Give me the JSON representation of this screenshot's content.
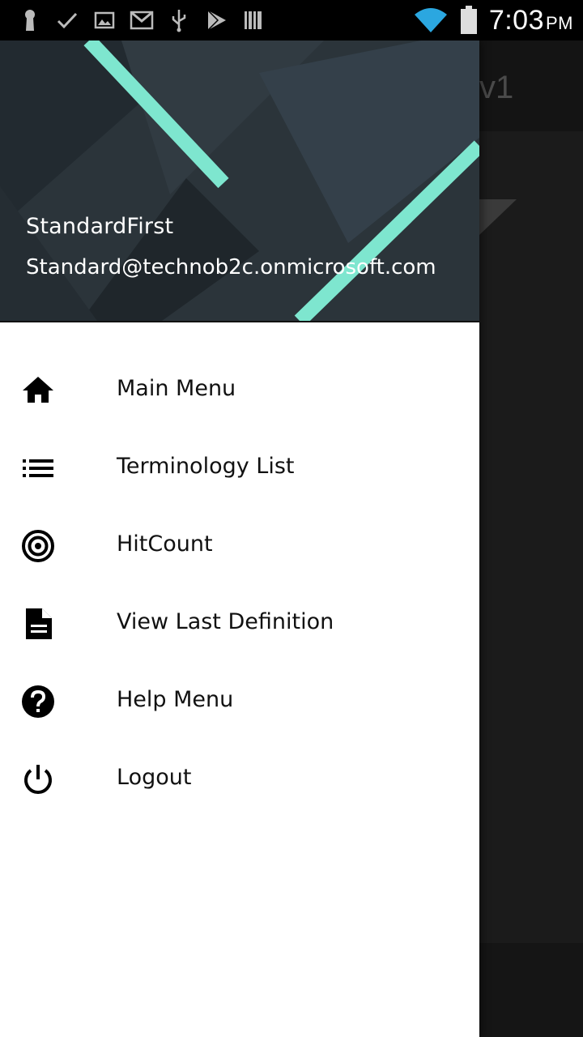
{
  "status_bar": {
    "time": "7:03",
    "ampm": "PM",
    "icons": [
      "keyhole-icon",
      "check-icon",
      "image-icon",
      "gmail-icon",
      "usb-icon",
      "play-store-icon",
      "barcode-icon",
      "wifi-icon",
      "battery-icon"
    ]
  },
  "background_app": {
    "title_fragment": "v1"
  },
  "drawer": {
    "user_name": "StandardFirst",
    "user_email": "Standard@technob2c.onmicrosoft.com",
    "accent_color": "#7ee6cf",
    "items": [
      {
        "label": "Main Menu",
        "icon": "home-icon"
      },
      {
        "label": "Terminology List",
        "icon": "list-icon"
      },
      {
        "label": "HitCount",
        "icon": "target-icon"
      },
      {
        "label": "View Last Definition",
        "icon": "document-icon"
      },
      {
        "label": "Help Menu",
        "icon": "help-icon"
      },
      {
        "label": "Logout",
        "icon": "power-icon"
      }
    ]
  }
}
